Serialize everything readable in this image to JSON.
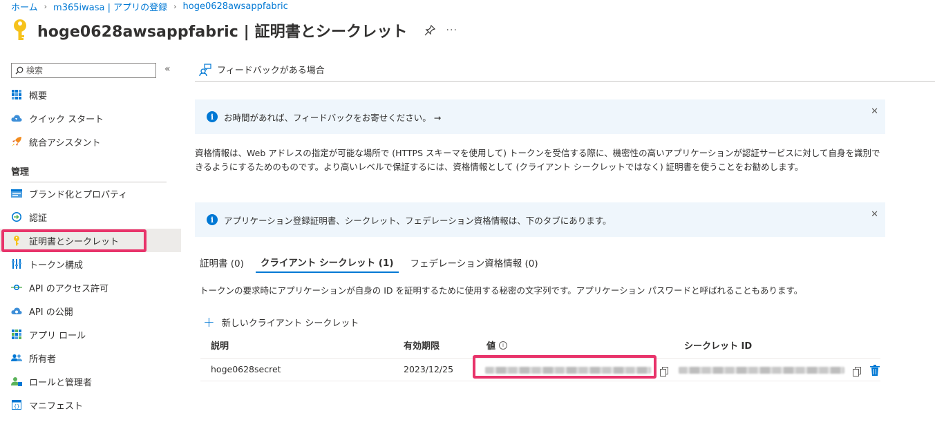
{
  "breadcrumb": {
    "home": "ホーム",
    "app_registration": "m365iwasa | アプリの登録",
    "app": "hoge0628awsappfabric"
  },
  "header": {
    "title": "hoge0628awsappfabric | 証明書とシークレット",
    "more": "···"
  },
  "sidebar": {
    "search_placeholder": "検索",
    "collapse": "«",
    "section_manage": "管理",
    "items": [
      {
        "label": "概要",
        "icon": "grid-icon"
      },
      {
        "label": "クイック スタート",
        "icon": "cloud-icon"
      },
      {
        "label": "統合アシスタント",
        "icon": "rocket-icon"
      },
      {
        "label": "ブランド化とプロパティ",
        "icon": "brand-icon"
      },
      {
        "label": "認証",
        "icon": "auth-icon"
      },
      {
        "label": "証明書とシークレット",
        "icon": "key-icon"
      },
      {
        "label": "トークン構成",
        "icon": "token-icon"
      },
      {
        "label": "API のアクセス許可",
        "icon": "api-permission-icon"
      },
      {
        "label": "API の公開",
        "icon": "cloud-api-icon"
      },
      {
        "label": "アプリ ロール",
        "icon": "app-roles-icon"
      },
      {
        "label": "所有者",
        "icon": "owners-icon"
      },
      {
        "label": "ロールと管理者",
        "icon": "roles-admin-icon"
      },
      {
        "label": "マニフェスト",
        "icon": "manifest-icon"
      }
    ]
  },
  "toolbar": {
    "feedback_label": "フィードバックがある場合"
  },
  "info_bars": {
    "feedback": "お時間があれば、フィードバックをお寄せください。 →",
    "tabs_note": "アプリケーション登録証明書、シークレット、フェデレーション資格情報は、下のタブにあります。",
    "close": "✕"
  },
  "description": "資格情報は、Web アドレスの指定が可能な場所で (HTTPS スキーマを使用して) トークンを受信する際に、機密性の高いアプリケーションが認証サービスに対して自身を識別できるようにするためのものです。より高いレベルで保証するには、資格情報として (クライアント シークレットではなく) 証明書を使うことをお勧めします。",
  "tabs": [
    {
      "label": "証明書 (0)"
    },
    {
      "label": "クライアント シークレット (1)"
    },
    {
      "label": "フェデレーション資格情報 (0)"
    }
  ],
  "tab_description": "トークンの要求時にアプリケーションが自身の ID を証明するために使用する秘密の文字列です。アプリケーション パスワードと呼ばれることもあります。",
  "new_secret_label": "新しいクライアント シークレット",
  "table": {
    "headers": {
      "description": "説明",
      "expires": "有効期限",
      "value": "値",
      "secret_id": "シークレット ID"
    },
    "rows": [
      {
        "description": "hoge0628secret",
        "expires": "2023/12/25"
      }
    ]
  },
  "colors": {
    "accent": "#0078d4",
    "highlight": "#e8336a",
    "info_bg": "#eff6fc",
    "active_nav": "#edebe9"
  }
}
